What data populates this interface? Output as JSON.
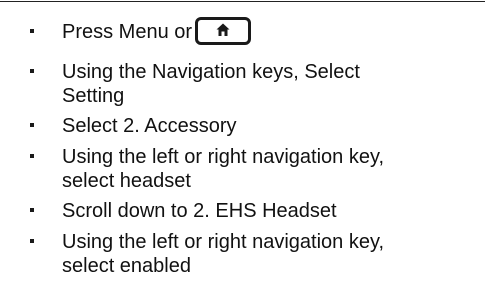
{
  "steps": [
    {
      "text": "Press Menu or",
      "icon": "home-key-icon"
    },
    {
      "lines": [
        "Using the Navigation keys, Select",
        "Setting"
      ]
    },
    {
      "text": "Select 2. Accessory"
    },
    {
      "lines": [
        "Using the left or right navigation key,",
        "select headset"
      ]
    },
    {
      "text": "Scroll down to 2. EHS Headset"
    },
    {
      "lines": [
        "Using the left or right navigation key,",
        "select enabled"
      ]
    }
  ]
}
